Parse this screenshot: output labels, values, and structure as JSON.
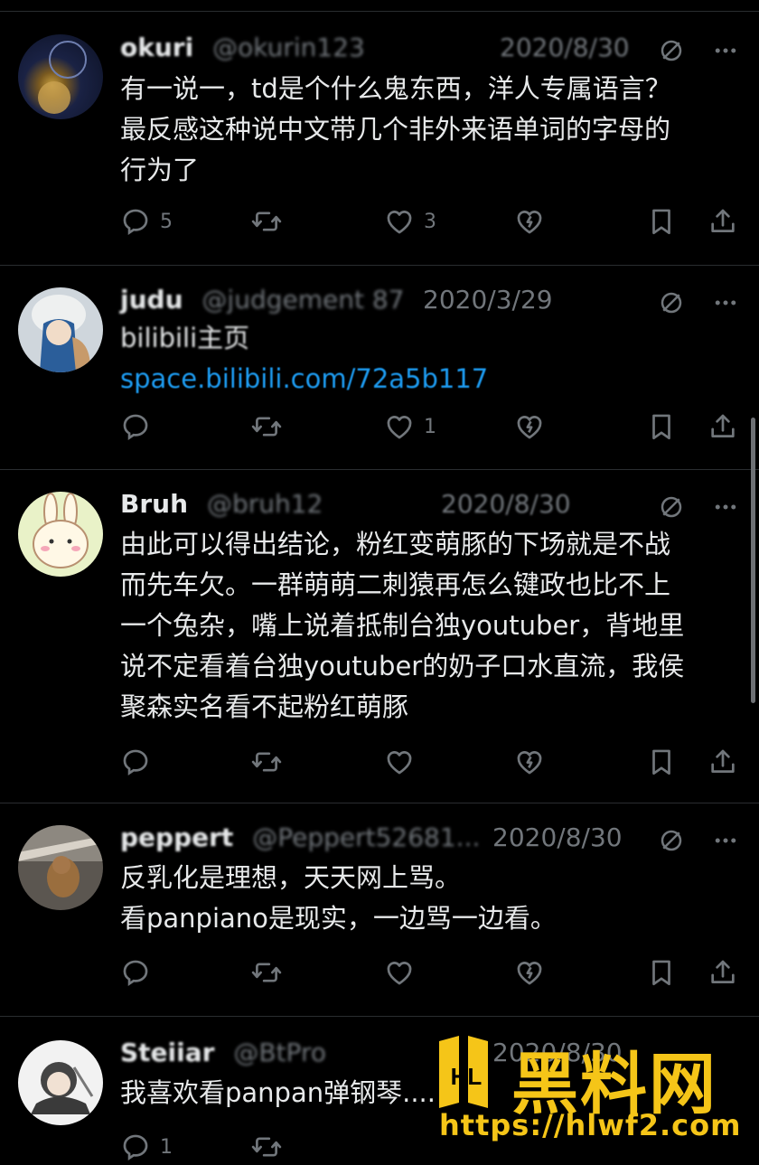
{
  "tweets": [
    {
      "name": "okuri",
      "handle": "@okurin123",
      "date": "2020/8/30",
      "lines": [
        "有一说一，td是个什么鬼东西，洋人专属语言？",
        "最反感这种说中文带几个非外来语单词的字母的",
        "行为了"
      ],
      "reply_count": "5",
      "retweet_count": "",
      "like_count": "3"
    },
    {
      "name": "judu",
      "handle": "@judgement 87",
      "date": "2020/3/29",
      "lines": [
        "bilibili主页"
      ],
      "link": "space.bilibili.com/72a5b117",
      "reply_count": "",
      "retweet_count": "",
      "like_count": "1"
    },
    {
      "name": "Bruh",
      "handle": "@bruh12",
      "date": "2020/8/30",
      "lines": [
        "由此可以得出结论，粉红变萌豚的下场就是不战",
        "而先车欠。一群萌萌二刺猿再怎么键政也比不上",
        "一个兔杂，嘴上说着抵制台独youtuber，背地里",
        "说不定看着台独youtuber的奶子口水直流，我侯",
        "聚森实名看不起粉红萌豚"
      ],
      "reply_count": "",
      "retweet_count": "",
      "like_count": ""
    },
    {
      "name": "peppert",
      "handle": "@Peppert52681...",
      "date": "2020/8/30",
      "lines": [
        "反乳化是理想，天天网上骂。",
        "看panpiano是现实，一边骂一边看。"
      ],
      "reply_count": "",
      "retweet_count": "",
      "like_count": ""
    },
    {
      "name": "Steiiar",
      "handle": "@BtPro",
      "date": "2020/8/30",
      "lines": [
        "我喜欢看panpan弹钢琴...."
      ],
      "reply_count": "1",
      "retweet_count": "",
      "like_count": ""
    }
  ],
  "watermark": {
    "logo": "HL",
    "text": "黑料网",
    "url": "https://hlwf2.com",
    "color": "#f5c518"
  },
  "icons": [
    "reply-icon",
    "retweet-icon",
    "like-icon",
    "grok-icon",
    "bookmark-icon",
    "share-icon",
    "block-icon",
    "more-icon"
  ]
}
